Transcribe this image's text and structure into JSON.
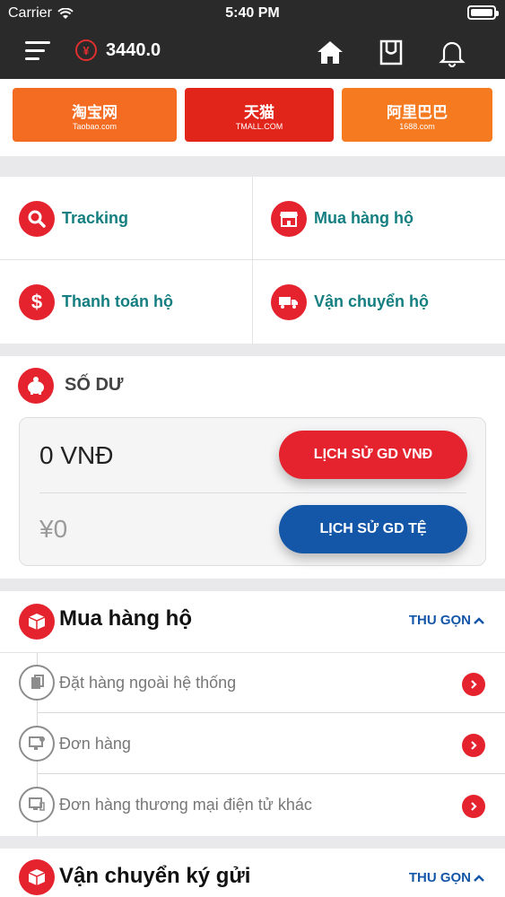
{
  "status_bar": {
    "carrier": "Carrier",
    "time": "5:40 PM"
  },
  "header": {
    "currency_symbol": "¥",
    "balance": "3440.0"
  },
  "stores": [
    {
      "name": "淘宝网",
      "sub": "Taobao.com",
      "color": "#f36c21"
    },
    {
      "name": "天猫",
      "sub": "TMALL.COM",
      "color": "#e1251b"
    },
    {
      "name": "阿里巴巴",
      "sub": "1688.com",
      "color": "#f57a20"
    }
  ],
  "services": [
    {
      "label": "Tracking",
      "icon": "search-icon"
    },
    {
      "label": "Mua hàng hộ",
      "icon": "store-icon"
    },
    {
      "label": "Thanh toán hộ",
      "icon": "dollar-icon"
    },
    {
      "label": "Vận chuyển hộ",
      "icon": "truck-icon"
    }
  ],
  "balance": {
    "title": "SỐ DƯ",
    "vnd": "0 VNĐ",
    "te": "¥0",
    "btn_vnd": "LỊCH SỬ GD VNĐ",
    "btn_te": "LỊCH SỬ GD TỆ"
  },
  "purchase": {
    "title": "Mua hàng hộ",
    "collapse_label": "THU GỌN",
    "items": [
      {
        "label": "Đặt hàng ngoài hệ thống",
        "icon": "document-icon"
      },
      {
        "label": "Đơn hàng",
        "icon": "monitor-icon"
      },
      {
        "label": "Đơn hàng thương mại điện tử khác",
        "icon": "desktop-icon"
      }
    ]
  },
  "transport": {
    "title": "Vận chuyển ký gửi",
    "collapse_label": "THU GỌN"
  },
  "colors": {
    "accent_red": "#e5232e",
    "accent_blue": "#1457a8",
    "teal_text": "#147e80",
    "header_bg": "#2a2a2a"
  }
}
